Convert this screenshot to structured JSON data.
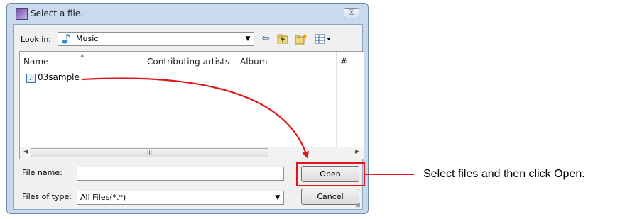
{
  "window": {
    "title": "Select a file.",
    "close_glyph": "☒"
  },
  "toolbar": {
    "look_in_label": "Look in:",
    "look_in_value": "Music",
    "icons": [
      "music-folder-icon",
      "back-arrow-icon",
      "up-folder-icon",
      "new-folder-icon",
      "view-menu-icon"
    ]
  },
  "list": {
    "columns": [
      "Name",
      "Contributing artists",
      "Album",
      "#"
    ],
    "items": [
      {
        "name": "03sample",
        "icon": "audio-file-icon"
      }
    ],
    "scroll_grip": "III"
  },
  "fields": {
    "file_name_label": "File name:",
    "file_name_value": "",
    "file_type_label": "Files of type:",
    "file_type_value": "All Files(*.*)"
  },
  "buttons": {
    "open": "Open",
    "cancel": "Cancel"
  },
  "annotation": {
    "callout_text": "Select files and then click Open.",
    "highlight_color": "#e0161b"
  }
}
